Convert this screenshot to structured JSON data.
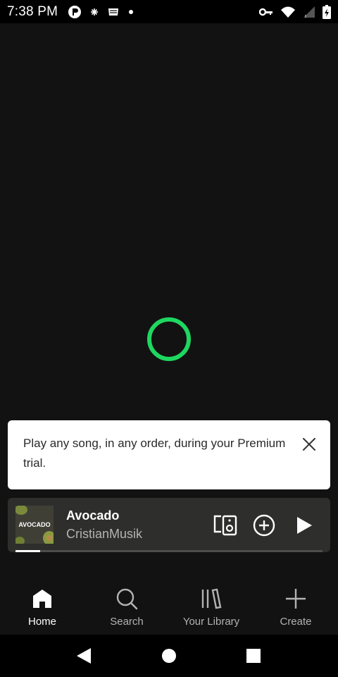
{
  "status_bar": {
    "time": "7:38 PM",
    "left_icons": [
      "app-notification-icon",
      "settings-small-icon",
      "cast-stack-icon",
      "dot-icon"
    ],
    "right_icons": [
      "vpn-key-icon",
      "wifi-icon",
      "signal-icon",
      "battery-charging-icon"
    ]
  },
  "toast": {
    "text": "Play any song, in any order, during your Premium trial."
  },
  "mini_player": {
    "album_art_text": "AVOCADO",
    "title": "Avocado",
    "artist": "CristianMusik",
    "progress_fraction": 0.08
  },
  "bottom_nav": {
    "items": [
      {
        "label": "Home",
        "icon": "home-icon",
        "active": true
      },
      {
        "label": "Search",
        "icon": "search-icon",
        "active": false
      },
      {
        "label": "Your Library",
        "icon": "library-icon",
        "active": false
      },
      {
        "label": "Create",
        "icon": "plus-icon",
        "active": false
      }
    ]
  },
  "colors": {
    "accent": "#1ed760",
    "background": "#121212",
    "player_bg": "#2e2e2c",
    "toast_bg": "#ffffff"
  }
}
